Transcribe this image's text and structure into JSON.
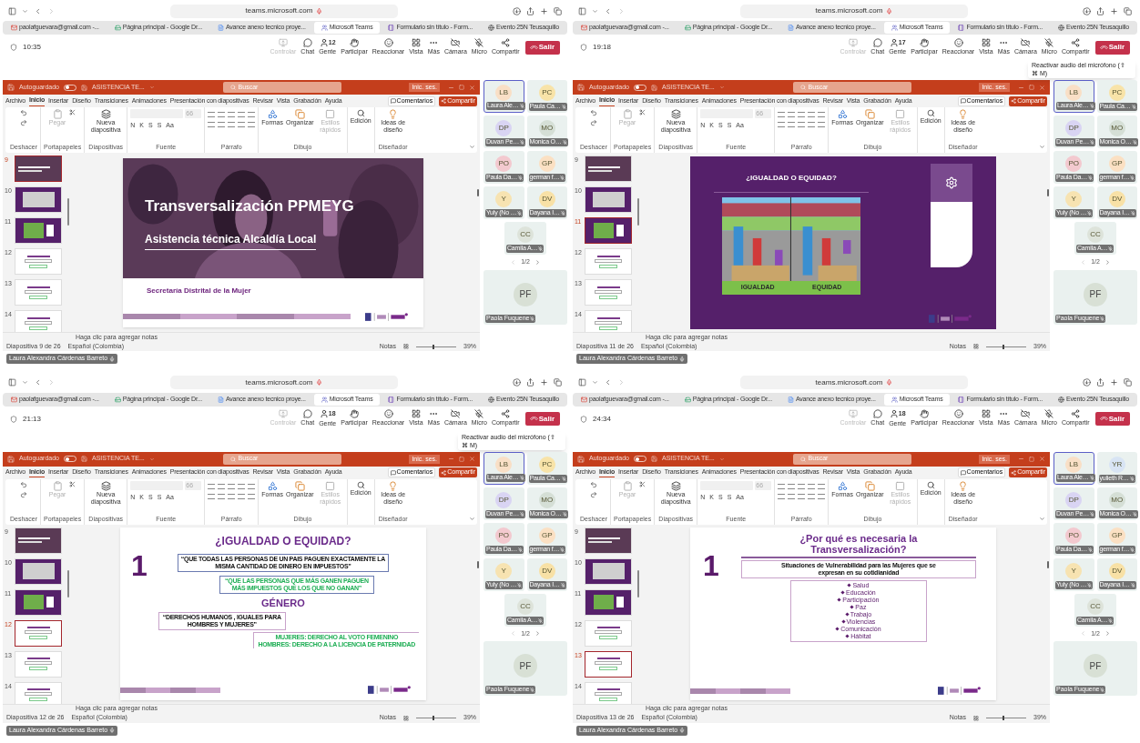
{
  "panels": [
    {
      "browser": {
        "address": "teams.microsoft.com",
        "tabs": [
          {
            "label": "paolafguevara@gmail.com -...",
            "kind": "mail",
            "selected": false
          },
          {
            "label": "Página principal - Google Dr...",
            "kind": "drive",
            "selected": false
          },
          {
            "label": "Avance anexo tecnico proye...",
            "kind": "doc",
            "selected": false
          },
          {
            "label": "Microsoft Teams",
            "kind": "teams",
            "selected": true
          },
          {
            "label": "Formulario sin título - Form...",
            "kind": "form",
            "selected": false
          },
          {
            "label": "Evento 25N Teusaquillo",
            "kind": "web",
            "selected": false
          }
        ]
      },
      "meeting": {
        "time": "10:35",
        "toolbar": [
          {
            "label": "Controlar",
            "kind": "control",
            "disabled": true
          },
          {
            "label": "Chat",
            "kind": "chat",
            "disabled": false
          },
          {
            "label": "Gente",
            "kind": "people",
            "badge": "12",
            "disabled": false
          },
          {
            "label": "Participar",
            "kind": "raise",
            "disabled": false
          },
          {
            "label": "Reaccionar",
            "kind": "react",
            "disabled": false
          },
          {
            "label": "Vista",
            "kind": "view",
            "disabled": false
          },
          {
            "label": "Más",
            "kind": "more",
            "disabled": false
          },
          {
            "label": "Cámara",
            "kind": "camera",
            "disabled": false
          },
          {
            "label": "Micro",
            "kind": "mic",
            "disabled": false
          },
          {
            "label": "Compartir",
            "kind": "share",
            "disabled": false
          }
        ],
        "leave": "Salir"
      },
      "ppt": {
        "autosave": "Autoguardado",
        "file": "ASISTENCIA TE...",
        "search": "Buscar",
        "signin": "Inic. ses.",
        "menu": [
          {
            "label": "Archivo",
            "selected": false
          },
          {
            "label": "Inicio",
            "selected": true
          },
          {
            "label": "Insertar",
            "selected": false
          },
          {
            "label": "Diseño",
            "selected": false
          },
          {
            "label": "Transiciones",
            "selected": false
          },
          {
            "label": "Animaciones",
            "selected": false
          },
          {
            "label": "Presentación con diapositivas",
            "selected": false
          },
          {
            "label": "Revisar",
            "selected": false
          },
          {
            "label": "Vista",
            "selected": false
          },
          {
            "label": "Grabación",
            "selected": false
          },
          {
            "label": "Ayuda",
            "selected": false
          }
        ],
        "comments": "Comentarios",
        "share": "Compartir",
        "ribbon": {
          "paste": {
            "label": "Pegar",
            "disabled": true
          },
          "new_slide": "Nueva diapositiva",
          "font_size": "66",
          "format_buttons": [
            "N",
            "K",
            "S",
            "S",
            "Aa"
          ],
          "shapes": "Formas",
          "arrange": "Organizar",
          "styles": {
            "label": "Estilos rápidos",
            "disabled": true
          },
          "editing": "Edición",
          "ideas": "Ideas de diseño",
          "groups": [
            "Deshacer",
            "Portapapeles",
            "Diapositivas",
            "Fuente",
            "Párrafo",
            "Dibujo",
            "Diseñador"
          ]
        },
        "thumbnails": [
          {
            "number": "9",
            "kind": "cover",
            "selected": true
          },
          {
            "number": "10",
            "kind": "blank",
            "selected": false
          },
          {
            "number": "11",
            "kind": "illustration",
            "selected": false
          },
          {
            "number": "12",
            "kind": "text",
            "selected": false
          },
          {
            "number": "13",
            "kind": "text",
            "selected": false
          },
          {
            "number": "14",
            "kind": "text",
            "selected": false
          }
        ],
        "slide": {
          "kind": "cover",
          "title": "Transversalización PPMEYG",
          "subtitle": "Asistencia técnica Alcaldía Local",
          "footer": "Secretaría Distrital de la Mujer"
        },
        "autosave_on": false,
        "notes": "Haga clic para agregar notas",
        "status": {
          "slide": "Diapositiva 9 de 26",
          "zoom_slider": {
            "level": 0.4
          },
          "language": "Español (Colombia)",
          "notes": "Notas",
          "zoom": "39%"
        }
      },
      "participants": {
        "tiles": [
          {
            "initials": "LB",
            "name": "Laura Ale…",
            "color": "#f9dfc6",
            "selected": true
          },
          {
            "initials": "PC",
            "name": "Paula Ca…",
            "color": "#f8e3a8",
            "selected": false
          },
          {
            "initials": "DP",
            "name": "Duvan Pe…",
            "color": "#d9d4f3",
            "selected": false
          },
          {
            "initials": "MO",
            "name": "Monica O…",
            "color": "#d5dfd6",
            "selected": false
          },
          {
            "initials": "PO",
            "name": "Paula Da…",
            "color": "#f3c9cf",
            "selected": false
          },
          {
            "initials": "GP",
            "name": "german f…",
            "color": "#fbe0c3",
            "selected": false
          },
          {
            "initials": "Y",
            "name": "Yuly (No …",
            "color": "#f7e3b1",
            "selected": false
          },
          {
            "initials": "DV",
            "name": "Dayana I…",
            "color": "#f8e1a6",
            "selected": false
          },
          {
            "initials": "CC",
            "name": "Camila A…",
            "color": "#dde3da",
            "selected": false
          }
        ],
        "pager": "1/2",
        "pinned": {
          "initials": "PF",
          "name": "Paola Fuquene",
          "color": "#d8e0d5"
        }
      },
      "presenter": "Laura Alexandra Cárdenas Barreto"
    },
    {
      "browser": {
        "address": "teams.microsoft.com",
        "tabs": [
          {
            "label": "paolafguevara@gmail.com -...",
            "kind": "mail",
            "selected": false
          },
          {
            "label": "Página principal - Google Dr...",
            "kind": "drive",
            "selected": false
          },
          {
            "label": "Avance anexo tecnico proye...",
            "kind": "doc",
            "selected": false
          },
          {
            "label": "Microsoft Teams",
            "kind": "teams",
            "selected": true
          },
          {
            "label": "Formulario sin título - Form...",
            "kind": "form",
            "selected": false
          },
          {
            "label": "Evento 25N Teusaquillo",
            "kind": "web",
            "selected": false
          }
        ]
      },
      "meeting": {
        "time": "19:18",
        "toolbar": [
          {
            "label": "Controlar",
            "kind": "control",
            "disabled": true
          },
          {
            "label": "Chat",
            "kind": "chat",
            "disabled": false
          },
          {
            "label": "Gente",
            "kind": "people",
            "badge": "17",
            "disabled": false
          },
          {
            "label": "Participar",
            "kind": "raise",
            "disabled": false
          },
          {
            "label": "Reaccionar",
            "kind": "react",
            "disabled": false
          },
          {
            "label": "Vista",
            "kind": "view",
            "disabled": false
          },
          {
            "label": "Más",
            "kind": "more",
            "disabled": false
          },
          {
            "label": "Cámara",
            "kind": "camera",
            "disabled": false
          },
          {
            "label": "Micro",
            "kind": "mic",
            "disabled": false
          },
          {
            "label": "Compartir",
            "kind": "share",
            "disabled": false
          }
        ],
        "leave": "Salir",
        "tooltip": "Reactivar audio del micrófono (⇧ ⌘ M)"
      },
      "ppt": {
        "autosave": "Autoguardado",
        "file": "ASISTENCIA TE...",
        "search": "Buscar",
        "signin": "Inic. ses.",
        "menu": [
          {
            "label": "Archivo",
            "selected": false
          },
          {
            "label": "Inicio",
            "selected": true
          },
          {
            "label": "Insertar",
            "selected": false
          },
          {
            "label": "Diseño",
            "selected": false
          },
          {
            "label": "Transiciones",
            "selected": false
          },
          {
            "label": "Animaciones",
            "selected": false
          },
          {
            "label": "Presentación con diapositivas",
            "selected": false
          },
          {
            "label": "Revisar",
            "selected": false
          },
          {
            "label": "Vista",
            "selected": false
          },
          {
            "label": "Grabación",
            "selected": false
          },
          {
            "label": "Ayuda",
            "selected": false
          }
        ],
        "comments": "Comentarios",
        "share": "Compartir",
        "ribbon": {
          "paste": {
            "label": "Pegar",
            "disabled": true
          },
          "new_slide": "Nueva diapositiva",
          "font_size": "66",
          "format_buttons": [
            "N",
            "K",
            "S",
            "S",
            "Aa"
          ],
          "shapes": "Formas",
          "arrange": "Organizar",
          "styles": {
            "label": "Estilos rápidos",
            "disabled": true
          },
          "editing": "Edición",
          "ideas": "Ideas de diseño",
          "groups": [
            "Deshacer",
            "Portapapeles",
            "Diapositivas",
            "Fuente",
            "Párrafo",
            "Dibujo",
            "Diseñador"
          ]
        },
        "thumbnails": [
          {
            "number": "9",
            "kind": "cover",
            "selected": false
          },
          {
            "number": "10",
            "kind": "blank",
            "selected": false
          },
          {
            "number": "11",
            "kind": "illustration",
            "selected": true
          },
          {
            "number": "12",
            "kind": "text",
            "selected": false
          },
          {
            "number": "13",
            "kind": "text",
            "selected": false
          },
          {
            "number": "14",
            "kind": "text",
            "selected": false
          }
        ],
        "slide": {
          "kind": "illustration",
          "title": "¿IGUALDAD O EQUIDAD?",
          "labels": [
            "IGUALDAD",
            "EQUIDAD"
          ]
        },
        "autosave_on": false,
        "notes": "Haga clic para agregar notas",
        "status": {
          "slide": "Diapositiva 11 de 26",
          "zoom_slider": {
            "level": 0.4
          },
          "language": "Español (Colombia)",
          "notes": "Notas",
          "zoom": "39%"
        }
      },
      "participants": {
        "tiles": [
          {
            "initials": "LB",
            "name": "Laura Ale…",
            "color": "#f9dfc6",
            "selected": true
          },
          {
            "initials": "PC",
            "name": "Paula Ca…",
            "color": "#f8e3a8",
            "selected": false
          },
          {
            "initials": "DP",
            "name": "Duvan Pe…",
            "color": "#d9d4f3",
            "selected": false
          },
          {
            "initials": "MO",
            "name": "Monica O…",
            "color": "#d5dfd6",
            "selected": false
          },
          {
            "initials": "PO",
            "name": "Paula Da…",
            "color": "#f3c9cf",
            "selected": false
          },
          {
            "initials": "GP",
            "name": "german f…",
            "color": "#fbe0c3",
            "selected": false
          },
          {
            "initials": "Y",
            "name": "Yuly (No …",
            "color": "#f7e3b1",
            "selected": false
          },
          {
            "initials": "DV",
            "name": "Dayana I…",
            "color": "#f8e1a6",
            "selected": false
          },
          {
            "initials": "CC",
            "name": "Camila A…",
            "color": "#dde3da",
            "selected": false
          }
        ],
        "pager": "1/2",
        "pinned": {
          "initials": "PF",
          "name": "Paola Fuquene",
          "color": "#d8e0d5"
        }
      },
      "presenter": "Laura Alexandra Cárdenas Barreto"
    },
    {
      "browser": {
        "address": "teams.microsoft.com",
        "tabs": [
          {
            "label": "paolafguevara@gmail.com -...",
            "kind": "mail",
            "selected": false
          },
          {
            "label": "Página principal - Google Dr...",
            "kind": "drive",
            "selected": false
          },
          {
            "label": "Avance anexo tecnico proye...",
            "kind": "doc",
            "selected": false
          },
          {
            "label": "Microsoft Teams",
            "kind": "teams",
            "selected": true
          },
          {
            "label": "Formulario sin título - Form...",
            "kind": "form",
            "selected": false
          },
          {
            "label": "Evento 25N Teusaquillo",
            "kind": "web",
            "selected": false
          }
        ]
      },
      "meeting": {
        "time": "21:13",
        "toolbar": [
          {
            "label": "Controlar",
            "kind": "control",
            "disabled": true
          },
          {
            "label": "Chat",
            "kind": "chat",
            "disabled": false
          },
          {
            "label": "Gente",
            "kind": "people",
            "badge": "18",
            "disabled": false
          },
          {
            "label": "Participar",
            "kind": "raise",
            "disabled": false
          },
          {
            "label": "Reaccionar",
            "kind": "react",
            "disabled": false
          },
          {
            "label": "Vista",
            "kind": "view",
            "disabled": false
          },
          {
            "label": "Más",
            "kind": "more",
            "disabled": false
          },
          {
            "label": "Cámara",
            "kind": "camera",
            "disabled": false
          },
          {
            "label": "Micro",
            "kind": "mic",
            "disabled": false
          },
          {
            "label": "Compartir",
            "kind": "share",
            "disabled": false
          }
        ],
        "leave": "Salir",
        "tooltip": "Reactivar audio del micrófono (⇧ ⌘ M)"
      },
      "ppt": {
        "autosave": "Autoguardado",
        "file": "ASISTENCIA TE...",
        "search": "Buscar",
        "signin": "Inic. ses.",
        "menu": [
          {
            "label": "Archivo",
            "selected": false
          },
          {
            "label": "Inicio",
            "selected": true
          },
          {
            "label": "Insertar",
            "selected": false
          },
          {
            "label": "Diseño",
            "selected": false
          },
          {
            "label": "Transiciones",
            "selected": false
          },
          {
            "label": "Animaciones",
            "selected": false
          },
          {
            "label": "Presentación con diapositivas",
            "selected": false
          },
          {
            "label": "Revisar",
            "selected": false
          },
          {
            "label": "Vista",
            "selected": false
          },
          {
            "label": "Grabación",
            "selected": false
          },
          {
            "label": "Ayuda",
            "selected": false
          }
        ],
        "comments": "Comentarios",
        "share": "Compartir",
        "ribbon": {
          "paste": {
            "label": "Pegar",
            "disabled": true
          },
          "new_slide": "Nueva diapositiva",
          "font_size": "66",
          "format_buttons": [
            "N",
            "K",
            "S",
            "S",
            "Aa"
          ],
          "shapes": "Formas",
          "arrange": "Organizar",
          "styles": {
            "label": "Estilos rápidos",
            "disabled": true
          },
          "editing": "Edición",
          "ideas": "Ideas de diseño",
          "groups": [
            "Deshacer",
            "Portapapeles",
            "Diapositivas",
            "Fuente",
            "Párrafo",
            "Dibujo",
            "Diseñador"
          ]
        },
        "thumbnails": [
          {
            "number": "9",
            "kind": "cover",
            "selected": false
          },
          {
            "number": "10",
            "kind": "blank",
            "selected": false
          },
          {
            "number": "11",
            "kind": "illustration",
            "selected": false
          },
          {
            "number": "12",
            "kind": "text",
            "selected": true
          },
          {
            "number": "13",
            "kind": "text",
            "selected": false
          },
          {
            "number": "14",
            "kind": "text",
            "selected": false
          }
        ],
        "slide": {
          "kind": "comparison",
          "number": "1",
          "title": "¿IGUALDAD O EQUIDAD?",
          "blocks": [
            {
              "kind": "quote",
              "lines": [
                "“QUE TODAS LAS PERSONAS DE UN PAIS PAGUEN EXACTAMENTE LA",
                "MISMA CANTIDAD DE DINERO EN IMPUESTOS”"
              ]
            },
            {
              "kind": "highlight",
              "lines": [
                "“QUE LAS PERSONAS QUE MÁS GANEN PAGUEN",
                "MÁS IMPUESTOS QUE LOS QUE NO GANAN”"
              ]
            },
            {
              "kind": "heading",
              "lines": [
                "GÉNERO"
              ]
            },
            {
              "kind": "quote-left",
              "lines": [
                "“DERECHOS HUMANOS , IGUALES PARA",
                "HOMBRES Y MUJERES”"
              ]
            },
            {
              "kind": "highlight-open",
              "lines": [
                "MUJERES: DERECHO AL VOTO FEMENINO",
                "HOMBRES: DERECHO A LA LICENCIA DE PATERNIDAD"
              ]
            }
          ]
        },
        "autosave_on": false,
        "notes": "Haga clic para agregar notas",
        "status": {
          "slide": "Diapositiva 12 de 26",
          "zoom_slider": {
            "level": 0.4
          },
          "language": "Español (Colombia)",
          "notes": "Notas",
          "zoom": "39%"
        }
      },
      "participants": {
        "tiles": [
          {
            "initials": "LB",
            "name": "Laura Ale…",
            "color": "#f9dfc6",
            "selected": true
          },
          {
            "initials": "PC",
            "name": "Paula Ca…",
            "color": "#f8e3a8",
            "selected": false
          },
          {
            "initials": "DP",
            "name": "Duvan Pe…",
            "color": "#d9d4f3",
            "selected": false
          },
          {
            "initials": "MO",
            "name": "Monica O…",
            "color": "#d5dfd6",
            "selected": false
          },
          {
            "initials": "PO",
            "name": "Paula Da…",
            "color": "#f3c9cf",
            "selected": false
          },
          {
            "initials": "GP",
            "name": "german f…",
            "color": "#fbe0c3",
            "selected": false
          },
          {
            "initials": "Y",
            "name": "Yuly (No …",
            "color": "#f7e3b1",
            "selected": false
          },
          {
            "initials": "DV",
            "name": "Dayana I…",
            "color": "#f8e1a6",
            "selected": false
          },
          {
            "initials": "CC",
            "name": "Camila A…",
            "color": "#dde3da",
            "selected": false
          }
        ],
        "pager": "1/2",
        "pinned": {
          "initials": "PF",
          "name": "Paola Fuquene",
          "color": "#d8e0d5"
        }
      },
      "presenter": "Laura Alexandra Cárdenas Barreto"
    },
    {
      "browser": {
        "address": "teams.microsoft.com",
        "tabs": [
          {
            "label": "paolafguevara@gmail.com -...",
            "kind": "mail",
            "selected": false
          },
          {
            "label": "Página principal - Google Dr...",
            "kind": "drive",
            "selected": false
          },
          {
            "label": "Avance anexo tecnico proye...",
            "kind": "doc",
            "selected": false
          },
          {
            "label": "Microsoft Teams",
            "kind": "teams",
            "selected": true
          },
          {
            "label": "Formulario sin título - Form...",
            "kind": "form",
            "selected": false
          },
          {
            "label": "Evento 25N Teusaquillo",
            "kind": "web",
            "selected": false
          }
        ]
      },
      "meeting": {
        "time": "24:34",
        "toolbar": [
          {
            "label": "Controlar",
            "kind": "control",
            "disabled": true
          },
          {
            "label": "Chat",
            "kind": "chat",
            "disabled": false
          },
          {
            "label": "Gente",
            "kind": "people",
            "badge": "18",
            "disabled": false
          },
          {
            "label": "Participar",
            "kind": "raise",
            "disabled": false
          },
          {
            "label": "Reaccionar",
            "kind": "react",
            "disabled": false
          },
          {
            "label": "Vista",
            "kind": "view",
            "disabled": false
          },
          {
            "label": "Más",
            "kind": "more",
            "disabled": false
          },
          {
            "label": "Cámara",
            "kind": "camera",
            "disabled": false
          },
          {
            "label": "Micro",
            "kind": "mic",
            "disabled": false
          },
          {
            "label": "Compartir",
            "kind": "share",
            "disabled": false
          }
        ],
        "leave": "Salir"
      },
      "ppt": {
        "autosave": "Autoguardado",
        "file": "ASISTENCIA TE...",
        "search": "Buscar",
        "signin": "Inic. ses.",
        "menu": [
          {
            "label": "Archivo",
            "selected": false
          },
          {
            "label": "Inicio",
            "selected": true
          },
          {
            "label": "Insertar",
            "selected": false
          },
          {
            "label": "Diseño",
            "selected": false
          },
          {
            "label": "Transiciones",
            "selected": false
          },
          {
            "label": "Animaciones",
            "selected": false
          },
          {
            "label": "Presentación con diapositivas",
            "selected": false
          },
          {
            "label": "Revisar",
            "selected": false
          },
          {
            "label": "Vista",
            "selected": false
          },
          {
            "label": "Grabación",
            "selected": false
          },
          {
            "label": "Ayuda",
            "selected": false
          }
        ],
        "comments": "Comentarios",
        "share": "Compartir",
        "ribbon": {
          "paste": {
            "label": "Pegar",
            "disabled": true
          },
          "new_slide": "Nueva diapositiva",
          "font_size": "66",
          "format_buttons": [
            "N",
            "K",
            "S",
            "S",
            "Aa"
          ],
          "shapes": "Formas",
          "arrange": "Organizar",
          "styles": {
            "label": "Estilos rápidos",
            "disabled": true
          },
          "editing": "Edición",
          "ideas": "Ideas de diseño",
          "groups": [
            "Deshacer",
            "Portapapeles",
            "Diapositivas",
            "Fuente",
            "Párrafo",
            "Dibujo",
            "Diseñador"
          ]
        },
        "thumbnails": [
          {
            "number": "9",
            "kind": "cover",
            "selected": false
          },
          {
            "number": "10",
            "kind": "blank",
            "selected": false
          },
          {
            "number": "11",
            "kind": "illustration",
            "selected": false
          },
          {
            "number": "12",
            "kind": "text",
            "selected": false
          },
          {
            "number": "13",
            "kind": "text",
            "selected": true
          },
          {
            "number": "14",
            "kind": "text",
            "selected": false
          }
        ],
        "slide": {
          "kind": "list",
          "number": "1",
          "title": [
            "¿Por qué es necesaria la",
            "Transversalización?"
          ],
          "subtitle": [
            "Situaciones de Vulnerabilidad para las Mujeres que se",
            "expresan en su cotidianidad"
          ],
          "items": [
            "Salud",
            "Educación",
            "Participación",
            "Paz",
            "Trabajo",
            "Violencias",
            "Comunicación",
            "Hábitat"
          ]
        },
        "autosave_on": false,
        "notes": "Haga clic para agregar notas",
        "status": {
          "slide": "Diapositiva 13 de 26",
          "zoom_slider": {
            "level": 0.4
          },
          "language": "Español (Colombia)",
          "notes": "Notas",
          "zoom": "39%"
        }
      },
      "participants": {
        "tiles": [
          {
            "initials": "LB",
            "name": "Laura Ale…",
            "color": "#f9dfc6",
            "selected": true
          },
          {
            "initials": "YR",
            "name": "yulieth R…",
            "color": "#d8e4f4",
            "selected": false
          },
          {
            "initials": "DP",
            "name": "Duvan Pe…",
            "color": "#d9d4f3",
            "selected": false
          },
          {
            "initials": "MO",
            "name": "Monica O…",
            "color": "#d5dfd6",
            "selected": false
          },
          {
            "initials": "PO",
            "name": "Paula Da…",
            "color": "#f3c9cf",
            "selected": false
          },
          {
            "initials": "GP",
            "name": "german f…",
            "color": "#fbe0c3",
            "selected": false
          },
          {
            "initials": "Y",
            "name": "Yuly (No …",
            "color": "#f7e3b1",
            "selected": false
          },
          {
            "initials": "DV",
            "name": "Dayana I…",
            "color": "#f8e1a6",
            "selected": false
          },
          {
            "initials": "CC",
            "name": "Camila A…",
            "color": "#dde3da",
            "selected": false
          }
        ],
        "pager": "1/2",
        "pinned": {
          "initials": "PF",
          "name": "Paola Fuquene",
          "color": "#d8e0d5"
        }
      },
      "presenter": "Laura Alexandra Cárdenas Barreto"
    }
  ]
}
